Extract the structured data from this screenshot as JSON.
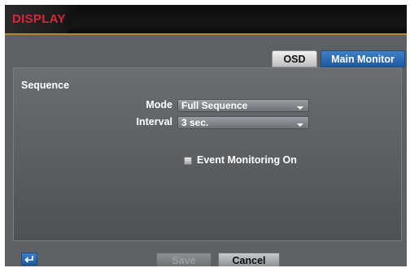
{
  "window": {
    "title": "DISPLAY"
  },
  "tabs": [
    {
      "label": "OSD",
      "active": false
    },
    {
      "label": "Main Monitor",
      "active": true
    }
  ],
  "section": {
    "title": "Sequence"
  },
  "fields": {
    "mode": {
      "label": "Mode",
      "value": "Full Sequence"
    },
    "interval": {
      "label": "Interval",
      "value": "3 sec."
    }
  },
  "event_monitoring": {
    "label": "Event Monitoring On",
    "checked": false
  },
  "footer": {
    "save_label": "Save",
    "cancel_label": "Cancel",
    "back_icon": "back-arrow-icon"
  },
  "colors": {
    "title": "#d9263a",
    "accent": "#2a6ab5",
    "title_underline": "#b58a22"
  }
}
